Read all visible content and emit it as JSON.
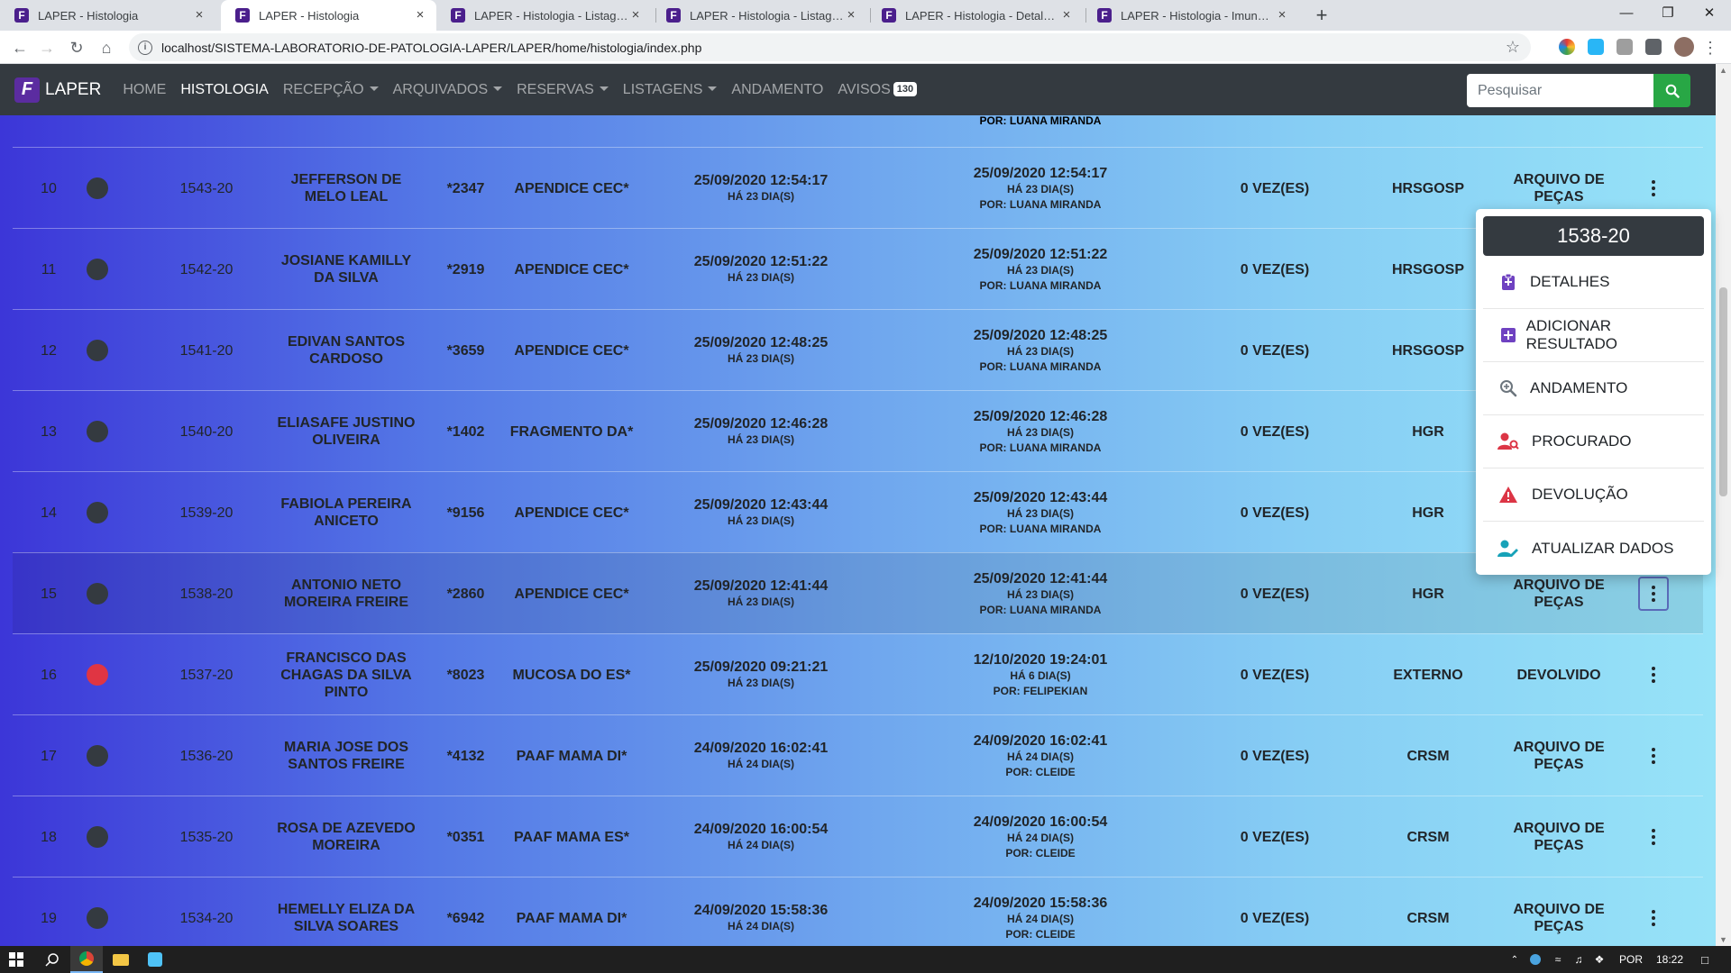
{
  "browser": {
    "tabs": [
      {
        "title": "LAPER - Histologia"
      },
      {
        "title": "LAPER - Histologia"
      },
      {
        "title": "LAPER - Histologia - Listagem ex"
      },
      {
        "title": "LAPER - Histologia - Listagem pr"
      },
      {
        "title": "LAPER - Histologia - Detalhes PC"
      },
      {
        "title": "LAPER - Histologia - Imuno-Histo"
      }
    ],
    "url": "localhost/SISTEMA-LABORATORIO-DE-PATOLOGIA-LAPER/LAPER/home/histologia/index.php"
  },
  "navbar": {
    "brand": "LAPER",
    "brand_logo": "F",
    "links": [
      {
        "label": "HOME"
      },
      {
        "label": "HISTOLOGIA"
      },
      {
        "label": "RECEPÇÃO"
      },
      {
        "label": "ARQUIVADOS"
      },
      {
        "label": "RESERVAS"
      },
      {
        "label": "LISTAGENS"
      },
      {
        "label": "ANDAMENTO"
      },
      {
        "label": "AVISOS"
      }
    ],
    "avisos_count": "130",
    "search_placeholder": "Pesquisar"
  },
  "table": {
    "partial_row": {
      "mov_by": "POR: LUANA MIRANDA"
    },
    "rows": [
      {
        "num": "10",
        "dot": "dark",
        "code": "1543-20",
        "name": "JEFFERSON DE MELO LEAL",
        "pront": "*2347",
        "material": "APENDICE CEC*",
        "date": "25/09/2020 12:54:17",
        "date_ago": "HÁ 23 DIA(S)",
        "mov_date": "25/09/2020 12:54:17",
        "mov_ago": "HÁ 23 DIA(S)",
        "mov_by": "POR: LUANA MIRANDA",
        "times": "0 VEZ(ES)",
        "origin": "HRSGOSP",
        "status": "ARQUIVO DE PEÇAS"
      },
      {
        "num": "11",
        "dot": "dark",
        "code": "1542-20",
        "name": "JOSIANE KAMILLY DA SILVA",
        "pront": "*2919",
        "material": "APENDICE CEC*",
        "date": "25/09/2020 12:51:22",
        "date_ago": "HÁ 23 DIA(S)",
        "mov_date": "25/09/2020 12:51:22",
        "mov_ago": "HÁ 23 DIA(S)",
        "mov_by": "POR: LUANA MIRANDA",
        "times": "0 VEZ(ES)",
        "origin": "HRSGOSP",
        "status": ""
      },
      {
        "num": "12",
        "dot": "dark",
        "code": "1541-20",
        "name": "EDIVAN SANTOS CARDOSO",
        "pront": "*3659",
        "material": "APENDICE CEC*",
        "date": "25/09/2020 12:48:25",
        "date_ago": "HÁ 23 DIA(S)",
        "mov_date": "25/09/2020 12:48:25",
        "mov_ago": "HÁ 23 DIA(S)",
        "mov_by": "POR: LUANA MIRANDA",
        "times": "0 VEZ(ES)",
        "origin": "HRSGOSP",
        "status": ""
      },
      {
        "num": "13",
        "dot": "dark",
        "code": "1540-20",
        "name": "ELIASAFE JUSTINO OLIVEIRA",
        "pront": "*1402",
        "material": "FRAGMENTO DA*",
        "date": "25/09/2020 12:46:28",
        "date_ago": "HÁ 23 DIA(S)",
        "mov_date": "25/09/2020 12:46:28",
        "mov_ago": "HÁ 23 DIA(S)",
        "mov_by": "POR: LUANA MIRANDA",
        "times": "0 VEZ(ES)",
        "origin": "HGR",
        "status": ""
      },
      {
        "num": "14",
        "dot": "dark",
        "code": "1539-20",
        "name": "FABIOLA PEREIRA ANICETO",
        "pront": "*9156",
        "material": "APENDICE CEC*",
        "date": "25/09/2020 12:43:44",
        "date_ago": "HÁ 23 DIA(S)",
        "mov_date": "25/09/2020 12:43:44",
        "mov_ago": "HÁ 23 DIA(S)",
        "mov_by": "POR: LUANA MIRANDA",
        "times": "0 VEZ(ES)",
        "origin": "HGR",
        "status": ""
      },
      {
        "num": "15",
        "dot": "dark",
        "code": "1538-20",
        "name": "ANTONIO NETO MOREIRA FREIRE",
        "pront": "*2860",
        "material": "APENDICE CEC*",
        "date": "25/09/2020 12:41:44",
        "date_ago": "HÁ 23 DIA(S)",
        "mov_date": "25/09/2020 12:41:44",
        "mov_ago": "HÁ 23 DIA(S)",
        "mov_by": "POR: LUANA MIRANDA",
        "times": "0 VEZ(ES)",
        "origin": "HGR",
        "status": "ARQUIVO DE PEÇAS"
      },
      {
        "num": "16",
        "dot": "red",
        "code": "1537-20",
        "name": "FRANCISCO DAS CHAGAS DA SILVA PINTO",
        "pront": "*8023",
        "material": "MUCOSA DO ES*",
        "date": "25/09/2020 09:21:21",
        "date_ago": "HÁ 23 DIA(S)",
        "mov_date": "12/10/2020 19:24:01",
        "mov_ago": "HÁ 6 DIA(S)",
        "mov_by": "POR: FELIPEKIAN",
        "times": "0 VEZ(ES)",
        "origin": "EXTERNO",
        "status": "DEVOLVIDO"
      },
      {
        "num": "17",
        "dot": "dark",
        "code": "1536-20",
        "name": "MARIA JOSE DOS SANTOS FREIRE",
        "pront": "*4132",
        "material": "PAAF MAMA DI*",
        "date": "24/09/2020 16:02:41",
        "date_ago": "HÁ 24 DIA(S)",
        "mov_date": "24/09/2020 16:02:41",
        "mov_ago": "HÁ 24 DIA(S)",
        "mov_by": "POR: CLEIDE",
        "times": "0 VEZ(ES)",
        "origin": "CRSM",
        "status": "ARQUIVO DE PEÇAS"
      },
      {
        "num": "18",
        "dot": "dark",
        "code": "1535-20",
        "name": "ROSA DE AZEVEDO MOREIRA",
        "pront": "*0351",
        "material": "PAAF MAMA ES*",
        "date": "24/09/2020 16:00:54",
        "date_ago": "HÁ 24 DIA(S)",
        "mov_date": "24/09/2020 16:00:54",
        "mov_ago": "HÁ 24 DIA(S)",
        "mov_by": "POR: CLEIDE",
        "times": "0 VEZ(ES)",
        "origin": "CRSM",
        "status": "ARQUIVO DE PEÇAS"
      },
      {
        "num": "19",
        "dot": "dark",
        "code": "1534-20",
        "name": "HEMELLY ELIZA DA SILVA SOARES",
        "pront": "*6942",
        "material": "PAAF MAMA DI*",
        "date": "24/09/2020 15:58:36",
        "date_ago": "HÁ 24 DIA(S)",
        "mov_date": "24/09/2020 15:58:36",
        "mov_ago": "HÁ 24 DIA(S)",
        "mov_by": "POR: CLEIDE",
        "times": "0 VEZ(ES)",
        "origin": "CRSM",
        "status": "ARQUIVO DE PEÇAS"
      }
    ]
  },
  "dropdown": {
    "header": "1538-20",
    "items": [
      {
        "label": "DETALHES",
        "icon": "clipboard-icon",
        "color": "#6f42c1"
      },
      {
        "label": "ADICIONAR RESULTADO",
        "icon": "plus-square-icon",
        "color": "#6f42c1"
      },
      {
        "label": "ANDAMENTO",
        "icon": "search-plus-icon",
        "color": "#6c757d"
      },
      {
        "label": "PROCURADO",
        "icon": "user-search-icon",
        "color": "#dc3545"
      },
      {
        "label": "DEVOLUÇÃO",
        "icon": "warning-icon",
        "color": "#dc3545"
      },
      {
        "label": "ATUALIZAR DADOS",
        "icon": "user-edit-icon",
        "color": "#17a2b8"
      }
    ]
  },
  "taskbar": {
    "lang": "POR",
    "time": "18:22"
  },
  "colors": {
    "navbar": "#343a40",
    "search_button": "#28a745",
    "dot_red": "#e03543"
  }
}
